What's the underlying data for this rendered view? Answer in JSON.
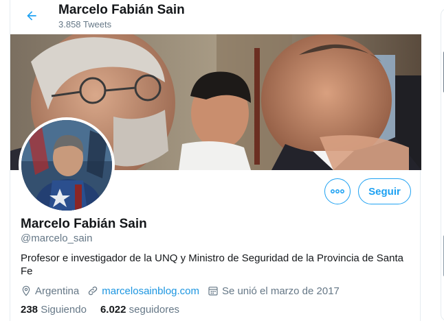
{
  "colors": {
    "accent": "#1da1f2",
    "link": "#1b95e0",
    "secondary_text": "#657786",
    "primary_text": "#14171a"
  },
  "header": {
    "name": "Marcelo Fabián Sain",
    "tweet_count": "3.858 Tweets",
    "back_icon": "arrow-left-icon"
  },
  "actions": {
    "more_icon": "more-dots-icon",
    "follow_label": "Seguir"
  },
  "profile": {
    "name": "Marcelo Fabián Sain",
    "handle": "@marcelo_sain",
    "bio": "Profesor e investigador de la UNQ y Ministro de Seguridad de la Provincia de Santa Fe",
    "location": "Argentina",
    "website": "marcelosainblog.com",
    "joined": "Se unió el marzo de 2017"
  },
  "stats": {
    "following_count": "238",
    "following_label": "Siguiendo",
    "followers_count": "6.022",
    "followers_label": "seguidores"
  }
}
